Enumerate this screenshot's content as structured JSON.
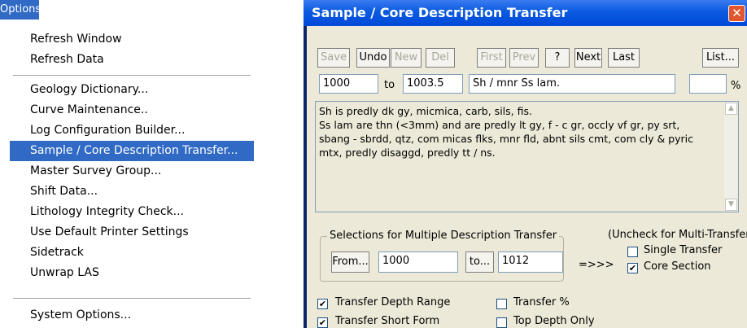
{
  "menu": {
    "title": "Options",
    "items": [
      {
        "label": "Refresh Window",
        "selected": false
      },
      {
        "label": "Refresh Data",
        "selected": false
      },
      {
        "label": "Geology Dictionary...",
        "selected": false
      },
      {
        "label": "Curve Maintenance..",
        "selected": false
      },
      {
        "label": "Log Configuration Builder...",
        "selected": false
      },
      {
        "label": "Sample / Core Description Transfer...",
        "selected": true
      },
      {
        "label": "Master Survey Group...",
        "selected": false
      },
      {
        "label": "Shift Data...",
        "selected": false
      },
      {
        "label": "Lithology Integrity Check...",
        "selected": false
      },
      {
        "label": "Use Default Printer Settings",
        "selected": false
      },
      {
        "label": "Sidetrack",
        "selected": false
      },
      {
        "label": "Unwrap LAS",
        "selected": false
      },
      {
        "label": "System Options...",
        "selected": false
      }
    ]
  },
  "dialog": {
    "title": "Sample / Core Description Transfer",
    "close_glyph": "✕",
    "toolbar": {
      "save": "Save",
      "undo": "Undo",
      "new": "New",
      "del": "Del",
      "first": "First",
      "prev": "Prev",
      "help": "?",
      "next": "Next",
      "last": "Last",
      "list": "List..."
    },
    "depth_from": "1000",
    "to_label": "to",
    "depth_to": "1003.5",
    "short_form": "Sh / mnr Ss lam.",
    "percent_value": "",
    "percent_label": "%",
    "description_lines": [
      "Sh is predly dk gy, micmica, carb, sils, fis.",
      "Ss lam are thn (<3mm) and are predly lt gy, f - c gr, occly vf gr, py srt,",
      "sbang - sbrdd, qtz, com micas flks, mnr fld, abnt sils cmt, com cly & pyric",
      "mtx, predly disaggd, predly tt / ns."
    ],
    "multi": {
      "title": "Selections for Multiple Description Transfer",
      "from_button": "From...",
      "from_value": "1000",
      "to_button": "to...",
      "to_value": "1012",
      "arrow": "=>>>"
    },
    "uncheck_note": "(Uncheck for Multi-Transfer)",
    "single_transfer": {
      "label": "Single Transfer",
      "checked": false
    },
    "core_section": {
      "label": "Core Section",
      "checked": true
    },
    "transfer_depth_range": {
      "label": "Transfer Depth Range",
      "checked": true
    },
    "transfer_short_form": {
      "label": "Transfer Short Form",
      "checked": true
    },
    "transfer_percent": {
      "label": "Transfer %",
      "checked": false
    },
    "top_depth_only": {
      "label": "Top Depth Only",
      "checked": false
    }
  }
}
